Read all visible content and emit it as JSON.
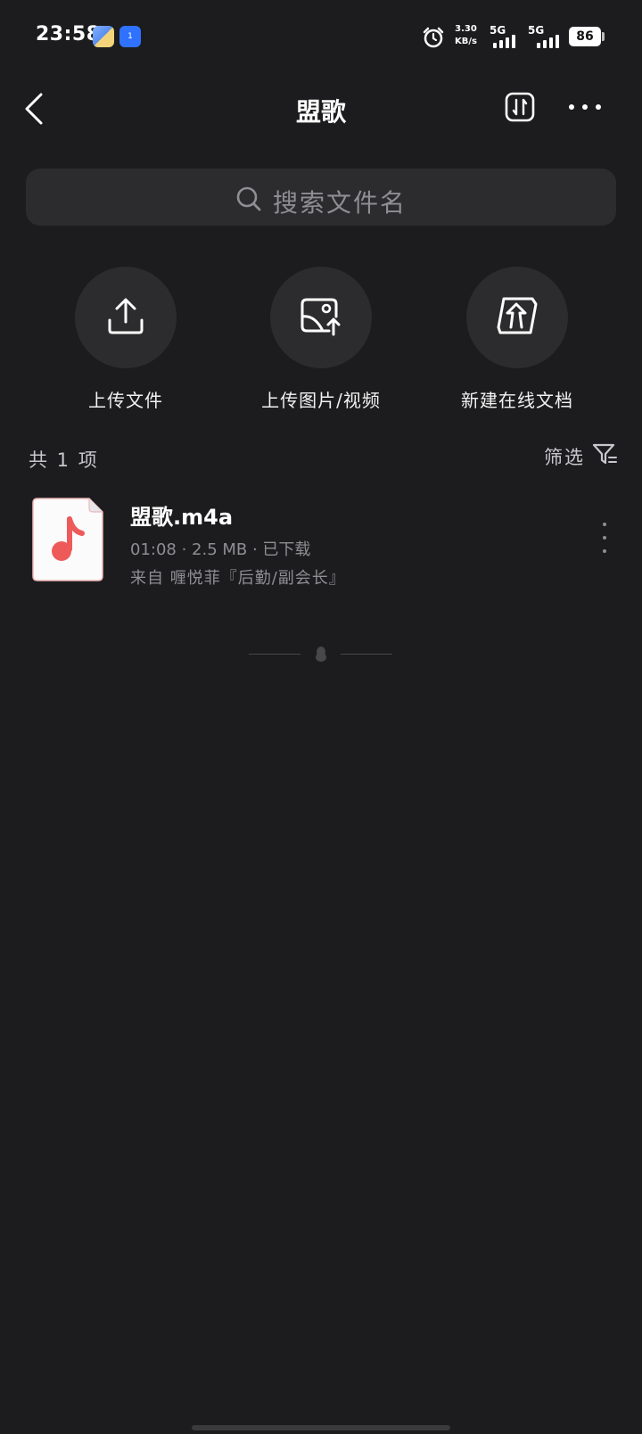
{
  "status_bar": {
    "time": "23:58",
    "badge_text": "1",
    "speed_value": "3.30",
    "speed_unit": "KB/s",
    "net1": "5G",
    "net2": "5G",
    "battery": "86"
  },
  "header": {
    "title": "盟歌",
    "back_icon": "chevron-left-icon",
    "transfer_icon": "swap-vertical-icon",
    "more_icon": "more-horizontal-icon"
  },
  "search": {
    "placeholder": "搜索文件名"
  },
  "actions": [
    {
      "label": "上传文件",
      "icon": "upload-icon"
    },
    {
      "label": "上传图片/视频",
      "icon": "upload-image-icon"
    },
    {
      "label": "新建在线文档",
      "icon": "new-doc-icon"
    }
  ],
  "list": {
    "count_label": "共 1 项",
    "filter_label": "筛选"
  },
  "files": [
    {
      "name": "盟歌.m4a",
      "meta": "01:08 · 2.5 MB · 已下载",
      "source": "来自 喱悦菲『后勤/副会长』",
      "icon": "music-file-icon",
      "accent": "#ee5a5a"
    }
  ]
}
